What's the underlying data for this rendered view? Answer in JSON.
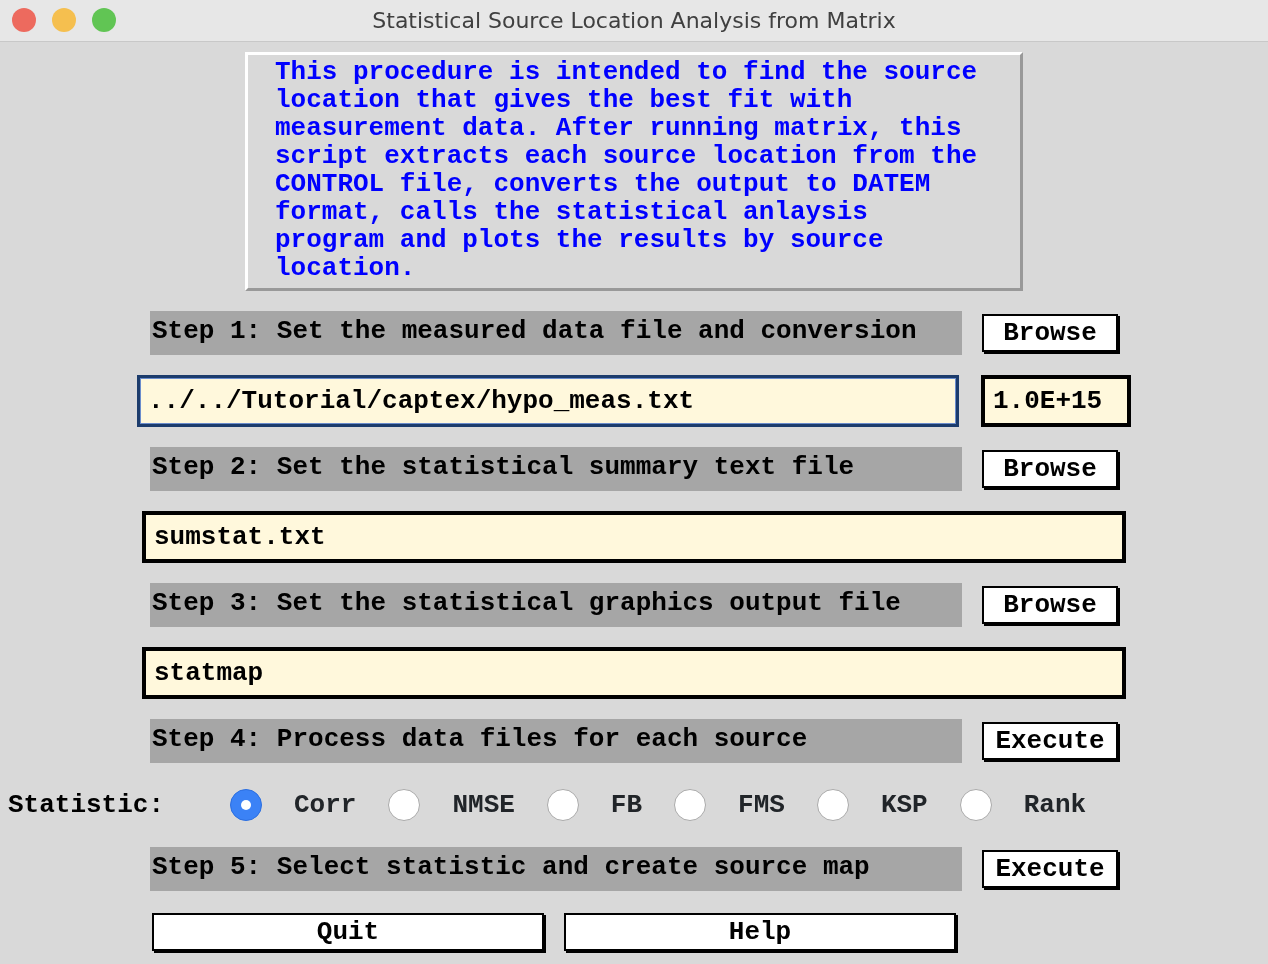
{
  "window": {
    "title": "Statistical Source Location Analysis from Matrix"
  },
  "description": "This procedure is intended to find the source location that gives the best fit with measurement data. After running matrix, this script extracts each source location from the CONTROL file, converts the output to DATEM format, calls the statistical anlaysis program and plots the results by source location.",
  "rows": [
    {
      "kind": "step",
      "label": "Step 1: Set the measured data file and conversion",
      "button": "Browse"
    },
    {
      "kind": "fields",
      "fields": [
        {
          "value": "../../Tutorial/captex/hypo_meas.txt",
          "focused": true
        },
        {
          "value": "1.0E+15",
          "focused": false
        }
      ]
    },
    {
      "kind": "step",
      "label": "Step 2: Set the statistical summary text file",
      "button": "Browse"
    },
    {
      "kind": "fields",
      "fields": [
        {
          "value": "sumstat.txt",
          "focused": false
        }
      ]
    },
    {
      "kind": "step",
      "label": "Step 3: Set the statistical graphics output file",
      "button": "Browse"
    },
    {
      "kind": "fields",
      "fields": [
        {
          "value": "statmap",
          "focused": false
        }
      ]
    },
    {
      "kind": "step",
      "label": "Step 4: Process data files for each source",
      "button": "Execute"
    },
    {
      "kind": "radios",
      "label": "Statistic:",
      "options": [
        {
          "label": "Corr",
          "selected": true
        },
        {
          "label": "NMSE",
          "selected": false
        },
        {
          "label": "FB",
          "selected": false
        },
        {
          "label": "FMS",
          "selected": false
        },
        {
          "label": "KSP",
          "selected": false
        },
        {
          "label": "Rank",
          "selected": false
        }
      ]
    },
    {
      "kind": "step",
      "label": "Step 5: Select statistic and create source map",
      "button": "Execute"
    }
  ],
  "buttons": [
    "Quit",
    "Help"
  ]
}
